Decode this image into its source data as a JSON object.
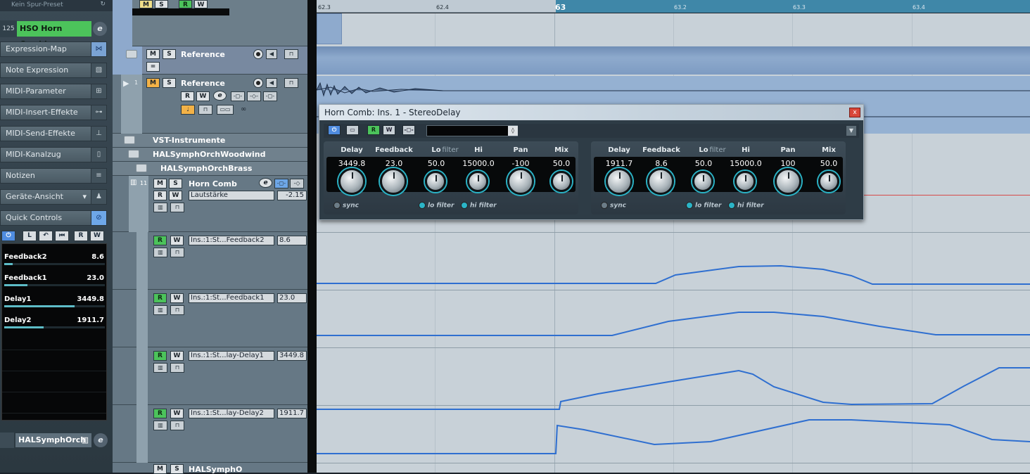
{
  "inspector": {
    "preset_label": "Kein Spur-Preset",
    "instrument_number": "125",
    "instrument_name": "HSO Horn Combi",
    "sections": [
      {
        "label": "Expression-Map",
        "icon": "bowtie-icon"
      },
      {
        "label": "Note Expression",
        "icon": "slash-box-icon"
      },
      {
        "label": "MIDI-Parameter",
        "icon": "fader-icon"
      },
      {
        "label": "MIDI-Insert-Effekte",
        "icon": "fader-icon"
      },
      {
        "label": "MIDI-Send-Effekte",
        "icon": "send-icon"
      },
      {
        "label": "MIDI-Kanalzug",
        "icon": "channel-icon"
      },
      {
        "label": "Notizen",
        "icon": "notes-icon"
      },
      {
        "label": "Geräte-Ansicht",
        "icon": "device-icon"
      },
      {
        "label": "Quick Controls",
        "icon": "no-entry-icon"
      }
    ],
    "qc_tools": [
      "⏻",
      "L",
      "↶",
      "⏮",
      "R",
      "W"
    ],
    "quick_controls": [
      {
        "name": "Feedback2",
        "value": "8.6",
        "level": 0.086
      },
      {
        "name": "Feedback1",
        "value": "23.0",
        "level": 0.23
      },
      {
        "name": "Delay1",
        "value": "3449.8",
        "level": 0.7
      },
      {
        "name": "Delay2",
        "value": "1911.7",
        "level": 0.39
      }
    ],
    "bottom_track_name": "HALSymphOrch"
  },
  "ruler": {
    "ticks": [
      {
        "label": "62.3",
        "kind": "minor"
      },
      {
        "label": "62.4",
        "kind": "minor"
      },
      {
        "label": "63",
        "kind": "bar"
      },
      {
        "label": "63.2",
        "kind": "minor"
      },
      {
        "label": "63.3",
        "kind": "minor"
      },
      {
        "label": "63.4",
        "kind": "minor"
      }
    ]
  },
  "top_buttons": {
    "m": "M",
    "s": "S",
    "r": "R",
    "w": "W"
  },
  "tracks": {
    "reference_folder": {
      "name": "Reference",
      "m": "M",
      "s": "S"
    },
    "reference_audio": {
      "number": "1",
      "name": "Reference",
      "m": "M",
      "s": "S",
      "r": "R",
      "w": "W",
      "e": "e"
    },
    "folders": [
      {
        "name": "VST-Instrumente"
      },
      {
        "name": "HALSymphOrchWoodwind"
      },
      {
        "name": "HALSymphOrchBrass"
      }
    ],
    "horn": {
      "number": "11",
      "name": "Horn Comb",
      "m": "M",
      "s": "S",
      "r": "R",
      "w": "W",
      "e": "e",
      "param": "Lautstärke",
      "value": "-2.15"
    },
    "automation": [
      {
        "param": "Ins.:1:St...Feedback2",
        "value": "8.6",
        "r": "R",
        "w": "W"
      },
      {
        "param": "Ins.:1:St...Feedback1",
        "value": "23.0",
        "r": "R",
        "w": "W"
      },
      {
        "param": "Ins.:1:St...lay-Delay1",
        "value": "3449.8",
        "r": "R",
        "w": "W"
      },
      {
        "param": "Ins.:1:St...lay-Delay2",
        "value": "1911.7",
        "r": "R",
        "w": "W"
      }
    ],
    "last": {
      "name": "HALSymphO",
      "m": "M",
      "s": "S"
    }
  },
  "plugin": {
    "title": "Horn Comb: Ins. 1 - StereoDelay",
    "close_label": "x",
    "buttons": {
      "r": "R",
      "w": "W"
    },
    "left": {
      "labels": [
        "Delay",
        "Feedback",
        "Lo",
        "filter",
        "Hi",
        "Pan",
        "Mix"
      ],
      "values": [
        "3449.8",
        "23.0",
        "50.0",
        "15000.0",
        "-100",
        "50.0"
      ],
      "toggles": {
        "sync": "sync",
        "lo": "lo filter",
        "hi": "hi filter"
      }
    },
    "right": {
      "labels": [
        "Delay",
        "Feedback",
        "Lo",
        "filter",
        "Hi",
        "Pan",
        "Mix"
      ],
      "values": [
        "1911.7",
        "8.6",
        "50.0",
        "15000.0",
        "100",
        "50.0"
      ],
      "toggles": {
        "sync": "sync",
        "lo": "lo filter",
        "hi": "hi filter"
      }
    }
  },
  "colors": {
    "accent_green": "#4cc35b",
    "accent_blue": "#4f8ce0",
    "knob_ring": "#2bb4c7",
    "automation_line": "#2f6fd0"
  }
}
